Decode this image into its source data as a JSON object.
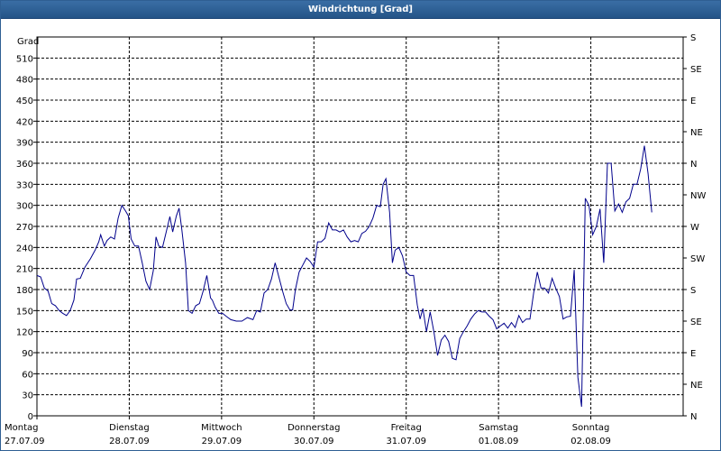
{
  "window": {
    "title": "Windrichtung [Grad]"
  },
  "chart_data": {
    "type": "line",
    "title": "Windrichtung [Grad]",
    "ylabel": "Grad",
    "ylim": [
      0,
      540
    ],
    "yticks": [
      0,
      30,
      60,
      90,
      120,
      150,
      180,
      210,
      240,
      270,
      300,
      330,
      360,
      390,
      420,
      450,
      480,
      510
    ],
    "y2_ticks": [
      {
        "value": 0,
        "label": "N"
      },
      {
        "value": 45,
        "label": "NE"
      },
      {
        "value": 90,
        "label": "E"
      },
      {
        "value": 135,
        "label": "SE"
      },
      {
        "value": 180,
        "label": "S"
      },
      {
        "value": 225,
        "label": "SW"
      },
      {
        "value": 270,
        "label": "W"
      },
      {
        "value": 315,
        "label": "NW"
      },
      {
        "value": 360,
        "label": "N"
      },
      {
        "value": 405,
        "label": "NE"
      },
      {
        "value": 450,
        "label": "E"
      },
      {
        "value": 495,
        "label": "SE"
      },
      {
        "value": 540,
        "label": "S"
      }
    ],
    "xlim": [
      0,
      7
    ],
    "days": [
      {
        "pos": 0,
        "name": "Montag",
        "date": "27.07.09"
      },
      {
        "pos": 1,
        "name": "Dienstag",
        "date": "28.07.09"
      },
      {
        "pos": 2,
        "name": "Mittwoch",
        "date": "29.07.09"
      },
      {
        "pos": 3,
        "name": "Donnerstag",
        "date": "30.07.09"
      },
      {
        "pos": 4,
        "name": "Freitag",
        "date": "31.07.09"
      },
      {
        "pos": 5,
        "name": "Samstag",
        "date": "01.08.09"
      },
      {
        "pos": 6,
        "name": "Sonntag",
        "date": "02.08.09"
      }
    ],
    "grid": true,
    "series": [
      {
        "color": "#00008b",
        "points": [
          [
            0.0,
            200
          ],
          [
            0.04,
            198
          ],
          [
            0.08,
            182
          ],
          [
            0.12,
            178
          ],
          [
            0.16,
            160
          ],
          [
            0.2,
            157
          ],
          [
            0.24,
            150
          ],
          [
            0.28,
            146
          ],
          [
            0.32,
            143
          ],
          [
            0.36,
            150
          ],
          [
            0.4,
            165
          ],
          [
            0.43,
            195
          ],
          [
            0.47,
            196
          ],
          [
            0.52,
            212
          ],
          [
            0.58,
            224
          ],
          [
            0.63,
            236
          ],
          [
            0.67,
            248
          ],
          [
            0.69,
            258
          ],
          [
            0.73,
            242
          ],
          [
            0.76,
            250
          ],
          [
            0.8,
            255
          ],
          [
            0.84,
            252
          ],
          [
            0.88,
            282
          ],
          [
            0.92,
            300
          ],
          [
            0.96,
            292
          ],
          [
            0.99,
            285
          ],
          [
            1.02,
            252
          ],
          [
            1.06,
            242
          ],
          [
            1.1,
            242
          ],
          [
            1.14,
            218
          ],
          [
            1.18,
            192
          ],
          [
            1.22,
            180
          ],
          [
            1.26,
            207
          ],
          [
            1.29,
            255
          ],
          [
            1.32,
            242
          ],
          [
            1.36,
            240
          ],
          [
            1.4,
            262
          ],
          [
            1.44,
            284
          ],
          [
            1.47,
            262
          ],
          [
            1.51,
            285
          ],
          [
            1.54,
            296
          ],
          [
            1.57,
            265
          ],
          [
            1.61,
            218
          ],
          [
            1.64,
            150
          ],
          [
            1.68,
            146
          ],
          [
            1.72,
            157
          ],
          [
            1.76,
            160
          ],
          [
            1.8,
            178
          ],
          [
            1.84,
            200
          ],
          [
            1.88,
            168
          ],
          [
            1.9,
            165
          ],
          [
            1.93,
            155
          ],
          [
            1.97,
            146
          ],
          [
            2.01,
            146
          ],
          [
            2.05,
            142
          ],
          [
            2.1,
            137
          ],
          [
            2.16,
            135
          ],
          [
            2.22,
            135
          ],
          [
            2.28,
            140
          ],
          [
            2.34,
            137
          ],
          [
            2.38,
            150
          ],
          [
            2.42,
            148
          ],
          [
            2.46,
            175
          ],
          [
            2.5,
            180
          ],
          [
            2.54,
            195
          ],
          [
            2.58,
            218
          ],
          [
            2.62,
            198
          ],
          [
            2.66,
            178
          ],
          [
            2.7,
            160
          ],
          [
            2.74,
            151
          ],
          [
            2.77,
            151
          ],
          [
            2.8,
            180
          ],
          [
            2.84,
            205
          ],
          [
            2.88,
            215
          ],
          [
            2.92,
            225
          ],
          [
            2.96,
            220
          ],
          [
            3.0,
            212
          ],
          [
            3.04,
            248
          ],
          [
            3.08,
            248
          ],
          [
            3.12,
            253
          ],
          [
            3.16,
            275
          ],
          [
            3.2,
            265
          ],
          [
            3.24,
            265
          ],
          [
            3.28,
            262
          ],
          [
            3.32,
            265
          ],
          [
            3.36,
            255
          ],
          [
            3.4,
            248
          ],
          [
            3.44,
            250
          ],
          [
            3.48,
            248
          ],
          [
            3.52,
            260
          ],
          [
            3.56,
            263
          ],
          [
            3.6,
            270
          ],
          [
            3.64,
            282
          ],
          [
            3.68,
            300
          ],
          [
            3.72,
            298
          ],
          [
            3.75,
            330
          ],
          [
            3.78,
            338
          ],
          [
            3.82,
            290
          ],
          [
            3.85,
            218
          ],
          [
            3.88,
            236
          ],
          [
            3.92,
            240
          ],
          [
            3.96,
            228
          ],
          [
            4.0,
            205
          ],
          [
            4.04,
            200
          ],
          [
            4.08,
            200
          ],
          [
            4.12,
            158
          ],
          [
            4.15,
            138
          ],
          [
            4.18,
            153
          ],
          [
            4.22,
            120
          ],
          [
            4.26,
            148
          ],
          [
            4.3,
            120
          ],
          [
            4.34,
            86
          ],
          [
            4.38,
            108
          ],
          [
            4.42,
            115
          ],
          [
            4.46,
            106
          ],
          [
            4.5,
            82
          ],
          [
            4.54,
            80
          ],
          [
            4.58,
            110
          ],
          [
            4.62,
            120
          ],
          [
            4.66,
            128
          ],
          [
            4.7,
            138
          ],
          [
            4.74,
            145
          ],
          [
            4.78,
            150
          ],
          [
            4.82,
            148
          ],
          [
            4.86,
            148
          ],
          [
            4.9,
            142
          ],
          [
            4.94,
            137
          ],
          [
            4.98,
            124
          ],
          [
            5.02,
            128
          ],
          [
            5.06,
            132
          ],
          [
            5.1,
            125
          ],
          [
            5.14,
            133
          ],
          [
            5.18,
            126
          ],
          [
            5.22,
            143
          ],
          [
            5.26,
            133
          ],
          [
            5.3,
            138
          ],
          [
            5.34,
            138
          ],
          [
            5.38,
            175
          ],
          [
            5.42,
            205
          ],
          [
            5.46,
            182
          ],
          [
            5.5,
            182
          ],
          [
            5.54,
            175
          ],
          [
            5.58,
            196
          ],
          [
            5.62,
            182
          ],
          [
            5.66,
            170
          ],
          [
            5.7,
            138
          ],
          [
            5.74,
            141
          ],
          [
            5.78,
            142
          ],
          [
            5.82,
            208
          ],
          [
            5.86,
            55
          ],
          [
            5.9,
            13
          ],
          [
            5.94,
            310
          ],
          [
            5.98,
            300
          ],
          [
            6.02,
            258
          ],
          [
            6.06,
            270
          ],
          [
            6.1,
            295
          ],
          [
            6.14,
            218
          ],
          [
            6.18,
            360
          ],
          [
            6.22,
            360
          ],
          [
            6.26,
            292
          ],
          [
            6.3,
            302
          ],
          [
            6.34,
            290
          ],
          [
            6.38,
            305
          ],
          [
            6.42,
            310
          ],
          [
            6.46,
            330
          ],
          [
            6.5,
            330
          ],
          [
            6.54,
            352
          ],
          [
            6.58,
            385
          ],
          [
            6.62,
            345
          ],
          [
            6.66,
            290
          ]
        ]
      }
    ]
  }
}
